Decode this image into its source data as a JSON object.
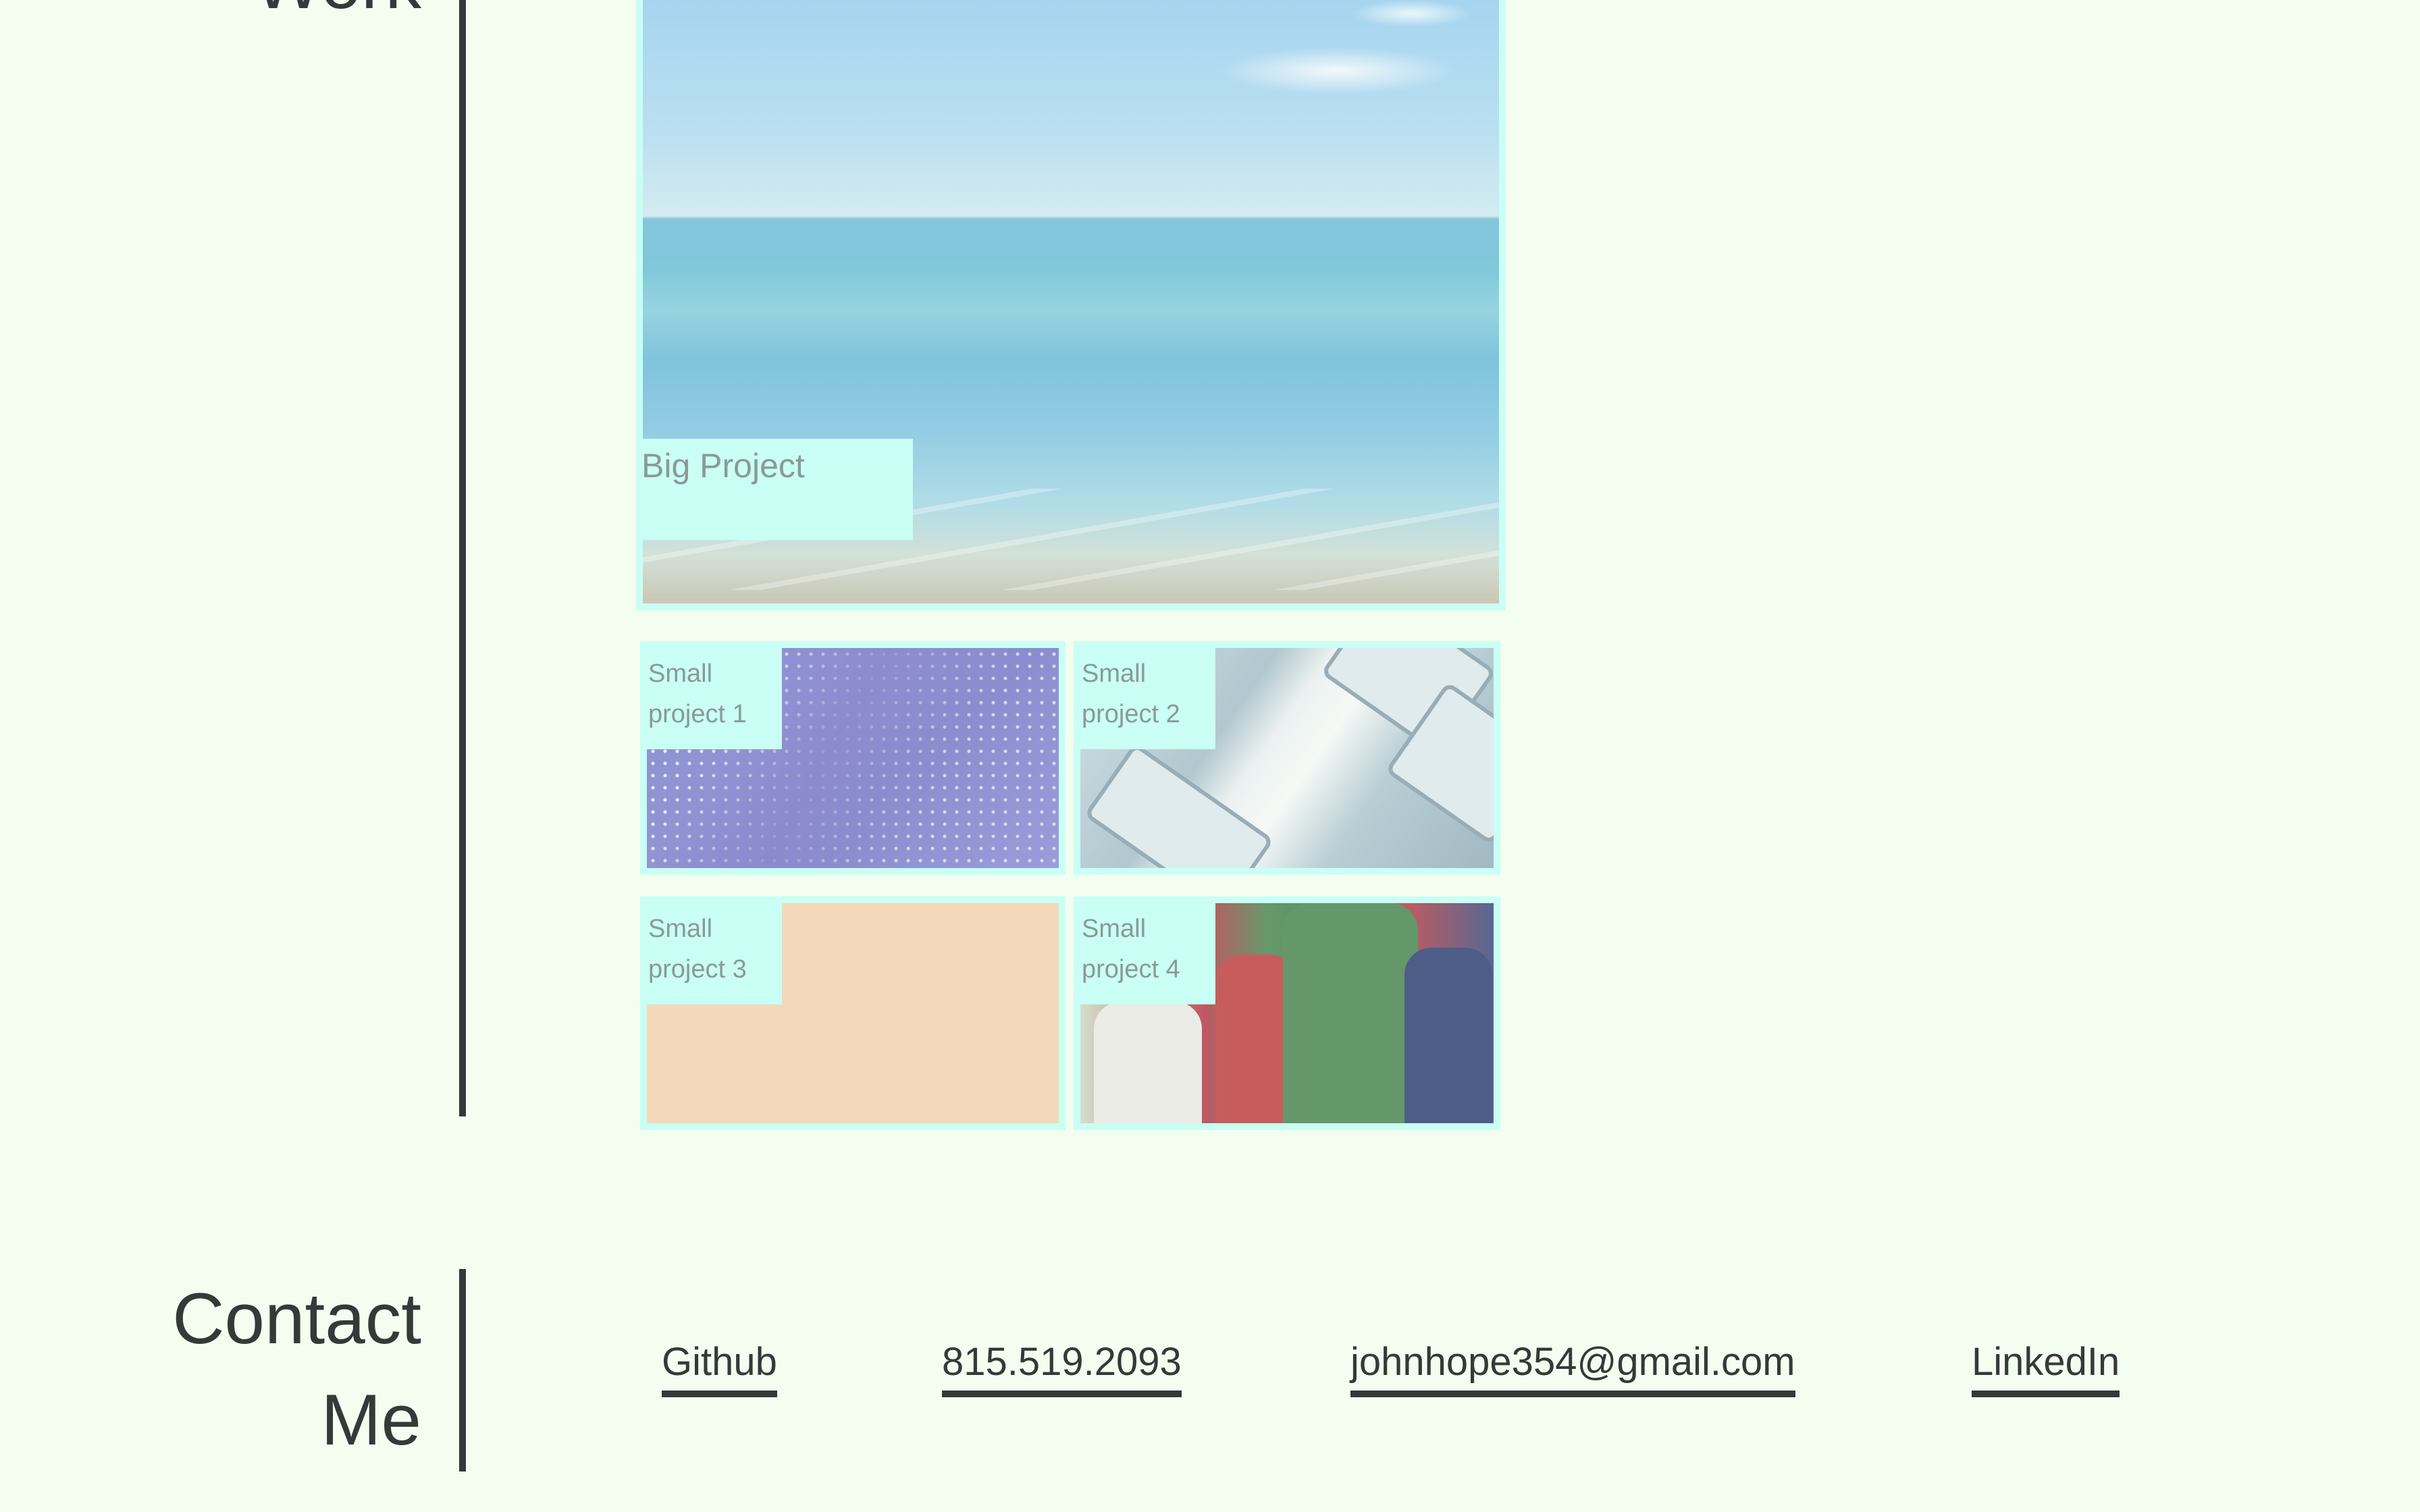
{
  "work": {
    "heading": "Work"
  },
  "projects": {
    "big": {
      "label": "Big Project"
    },
    "small": [
      {
        "label_line1": "Small",
        "label_line2": "project 1"
      },
      {
        "label_line1": "Small",
        "label_line2": "project 2"
      },
      {
        "label_line1": "Small",
        "label_line2": "project 3"
      },
      {
        "label_line1": "Small",
        "label_line2": "project 4"
      }
    ]
  },
  "contact": {
    "heading_line1": "Contact",
    "heading_line2": "Me",
    "links": {
      "github": "Github",
      "phone": "815.519.2093",
      "email": "johnhope354@gmail.com",
      "linkedin": "LinkedIn"
    }
  },
  "colors": {
    "background": "#f4fef0",
    "text": "#333a38",
    "card_border": "#c9fff4",
    "label_text": "#8a9a96"
  }
}
